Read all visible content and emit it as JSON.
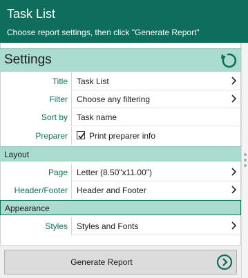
{
  "header": {
    "title": "Task List",
    "subtitle": "Choose report settings, then click \"Generate Report\""
  },
  "settings": {
    "heading": "Settings",
    "reset_icon": "reset-icon",
    "rows": {
      "title": {
        "label": "Title",
        "value": "Task List"
      },
      "filter": {
        "label": "Filter",
        "value": "Choose any filtering"
      },
      "sort_by": {
        "label": "Sort by",
        "value": "Task name"
      },
      "preparer": {
        "label": "Preparer",
        "checkbox_label": "Print preparer info",
        "checked": true
      }
    }
  },
  "layout": {
    "heading": "Layout",
    "rows": {
      "page": {
        "label": "Page",
        "value": "Letter (8.50\"x11.00\")"
      },
      "header_footer": {
        "label": "Header/Footer",
        "value": "Header and Footer"
      }
    }
  },
  "appearance": {
    "heading": "Appearance",
    "rows": {
      "styles": {
        "label": "Styles",
        "value": "Styles and Fonts"
      }
    }
  },
  "footer": {
    "generate_label": "Generate Report",
    "generate_icon": "chevron-right-circle-icon"
  },
  "colors": {
    "accent": "#0d6e5c",
    "section_bg": "#a9dccf"
  }
}
